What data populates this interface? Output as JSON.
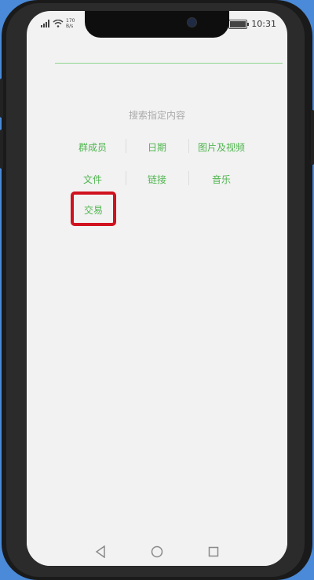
{
  "status_bar": {
    "network_speed": "170\nB/s",
    "time": "10:31",
    "battery_level": 0.9
  },
  "search": {
    "section_title": "搜索指定内容",
    "options": [
      {
        "label": "群成员"
      },
      {
        "label": "日期"
      },
      {
        "label": "图片及视频"
      },
      {
        "label": "文件"
      },
      {
        "label": "链接"
      },
      {
        "label": "音乐"
      },
      {
        "label": "交易"
      }
    ]
  },
  "colors": {
    "accent": "#4fb54f",
    "highlight": "#d0121f",
    "background": "#4a8ad8"
  }
}
